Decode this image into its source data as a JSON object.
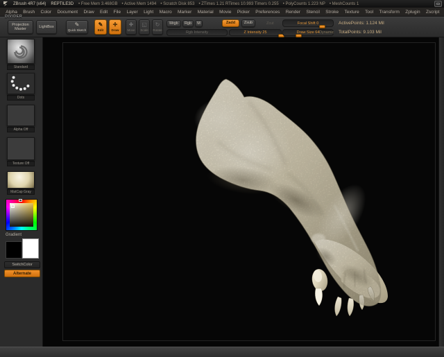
{
  "title_bar": {
    "app_name": "ZBrush 4R7 (x64)",
    "document_name": "REPTILE3D",
    "stats": [
      "• Free Mem 3.468GB",
      "• Active Mem 1494",
      "• Scratch Disk 853",
      "• ZTimes 1.21 RTimes 10.993 Timers 0.255",
      "• PolyCounts 1.223 NP",
      "• MeshCounts 1"
    ]
  },
  "menu_bar": {
    "items": [
      "Alpha",
      "Brush",
      "Color",
      "Document",
      "Draw",
      "Edit",
      "File",
      "Layer",
      "Light",
      "Macro",
      "Marker",
      "Material",
      "Movie",
      "Picker",
      "Preferences",
      "Render",
      "Stencil",
      "Stroke",
      "Texture",
      "Tool",
      "Transform",
      "Zplugin",
      "Zscript"
    ]
  },
  "toolbar": {
    "custom_menu_label": "DIVIDER",
    "projection_master": "Projection Master",
    "lightbox": "LightBox",
    "quick_sketch": "Quick Sketch",
    "edit": "Edit",
    "draw": "Draw",
    "move": "Move",
    "scale": "Scale",
    "rotate": "Rotate",
    "mrgb": "Mrgb",
    "rgb": "Rgb",
    "m": "M",
    "zadd": "Zadd",
    "zsub": "Zsub",
    "zcut": "Zcut",
    "rgb_intensity": "Rgb Intensity",
    "z_intensity": "Z Intensity 25",
    "focal_shift": "Focal Shift 0",
    "draw_size": "Draw Size 64",
    "dynamic": "Dynamic",
    "active_points": "ActivePoints: 1.124 Mil",
    "total_points": "TotalPoints: 9.103 Mil"
  },
  "icons": {
    "edit_glyph": "✎",
    "draw_glyph": "✛",
    "move_glyph": "✚",
    "scale_glyph": "◱",
    "rotate_glyph": "↻",
    "quick_sketch_glyph": "✎"
  },
  "sidebar": {
    "brush_label": "Standard",
    "stroke_label": "Dots",
    "alpha_label": "Alpha Off",
    "texture_label": "Texture Off",
    "material_label": "MatCap Gray",
    "gradient_label": "Gradient",
    "switch_color": "SwitchColor",
    "alternate": "Alternate"
  },
  "colors": {
    "accent_orange": "#e8890f",
    "toolbar_bg": "#333333",
    "canvas_bg": "#060606",
    "model_base": "#d8d0b6",
    "model_highlight": "#f1ebd9",
    "model_shadow": "#8f8770"
  }
}
